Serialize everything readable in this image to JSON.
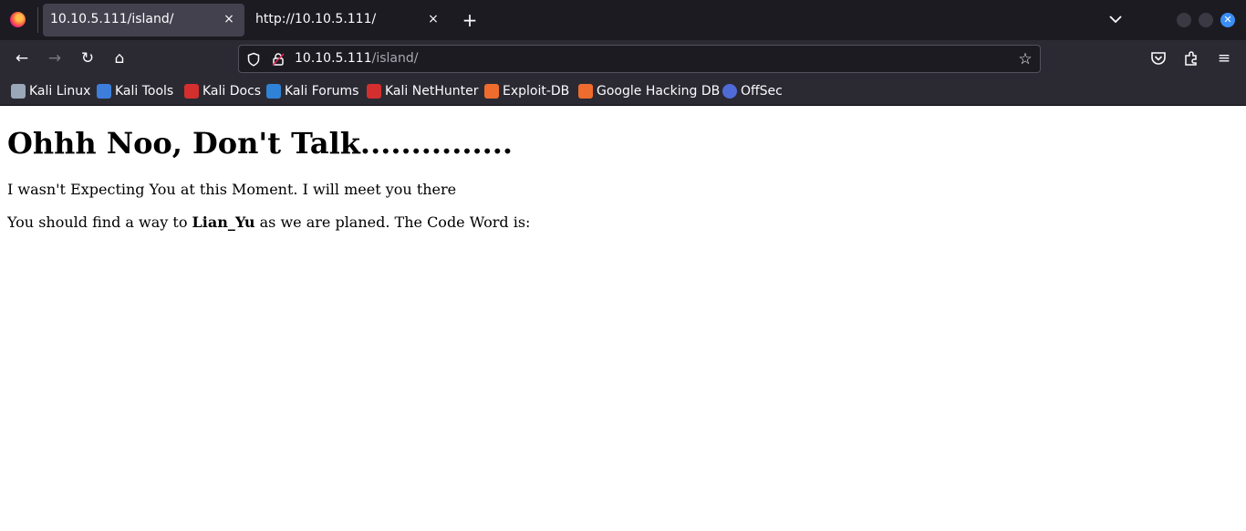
{
  "tabs": [
    {
      "title": "10.10.5.111/island/",
      "active": true
    },
    {
      "title": "http://10.10.5.111/",
      "active": false
    }
  ],
  "icons": {
    "tab_close": "×",
    "new_tab": "+",
    "back": "←",
    "forward": "→",
    "reload": "↻",
    "home": "⌂",
    "star": "☆",
    "menu": "≡",
    "window_close": "✕"
  },
  "url": {
    "host": "10.10.5.111",
    "path": "/island/"
  },
  "bookmarks": [
    {
      "label": "Kali Linux",
      "color": "#9aa7b8"
    },
    {
      "label": "Kali Tools",
      "color": "#3d7edb"
    },
    {
      "label": "Kali Docs",
      "color": "#d32f2f"
    },
    {
      "label": "Kali Forums",
      "color": "#2f82d6"
    },
    {
      "label": "Kali NetHunter",
      "color": "#d32f2f"
    },
    {
      "label": "Exploit-DB",
      "color": "#ef6c2f"
    },
    {
      "label": "Google Hacking DB",
      "color": "#ef6c2f"
    },
    {
      "label": "OffSec",
      "color": "#4f6bd8"
    }
  ],
  "content": {
    "heading": "Ohhh Noo, Don't Talk...............",
    "line1": "I wasn't Expecting You at this Moment. I will meet you there",
    "line2_before": "You should find a way to ",
    "line2_bold": "Lian_Yu",
    "line2_after": " as we are planed. The Code Word is:"
  },
  "colors": {
    "tabbar_bg": "#1c1b22",
    "toolbar_bg": "#2b2a33",
    "active_tab_bg": "#42414d",
    "accent": "#3a8ef6"
  }
}
